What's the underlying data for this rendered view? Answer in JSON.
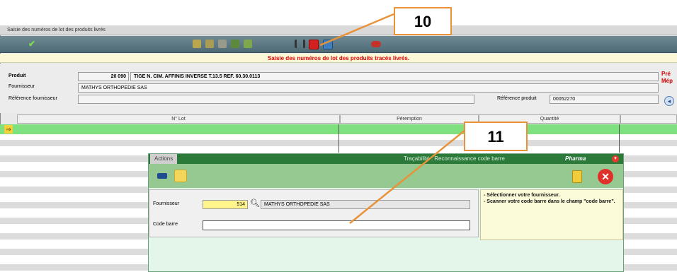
{
  "window": {
    "title": "Saisie des numéros de lot des produits livrés"
  },
  "header": {
    "banner": "Saisie des numéros de lot des produits tracés livrés."
  },
  "product": {
    "label": "Produit",
    "code": "20 090",
    "name": "TIGE N. CIM. AFFINIS INVERSE T.13.5 REF. 60.30.0113",
    "supplier_label": "Fournisseur",
    "supplier": "MATHYS ORTHOPEDIE SAS",
    "supplier_ref_label": "Référence fournisseur",
    "supplier_ref": "",
    "product_ref_label": "Référence produit",
    "product_ref": "00052270",
    "side_text_1": "Pré",
    "side_text_2": "Mép"
  },
  "grid": {
    "columns": [
      "N° Lot",
      "Péremption",
      "Quantité"
    ]
  },
  "annotations": {
    "a10": "10",
    "a11": "11"
  },
  "dialog": {
    "title_left": "Actions",
    "title_right": "Traçabilité : Reconnaissance code barre",
    "brand": "Pharma",
    "supplier_label": "Fournisseur",
    "supplier_code": "514",
    "supplier_name": "MATHYS ORTHOPEDIE SAS",
    "barcode_label": "Code barre",
    "barcode_value": "",
    "help_line1": "- Sélectionner votre fournisseur.",
    "help_line2": "- Scanner votre code barre dans le champ \"code barre\"."
  },
  "colors": {
    "accent": "#e8923a",
    "banner_text": "#e00000",
    "toolbar": "#5a7580",
    "selected_row": "#7ee07e",
    "dialog_title": "#2c7a3a"
  }
}
